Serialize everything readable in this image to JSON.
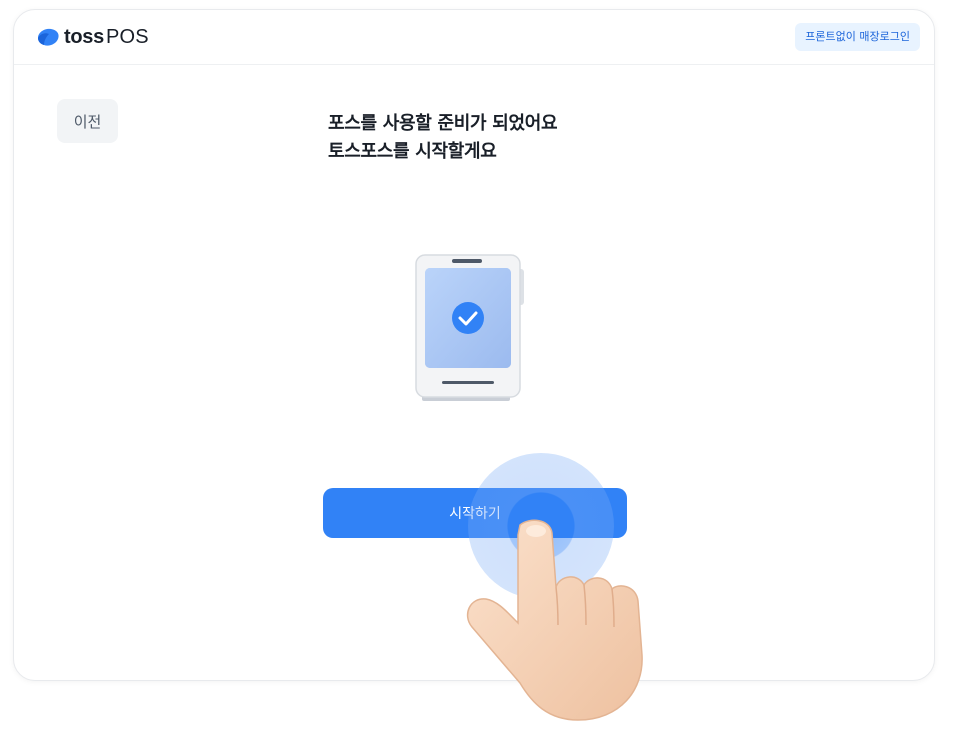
{
  "header": {
    "logo_toss": "toss",
    "logo_pos": "POS",
    "front_login_label": "프론트없이 매장로그인"
  },
  "nav": {
    "back_label": "이전"
  },
  "main": {
    "headline_line1": "포스를 사용할 준비가 되었어요",
    "headline_line2": "토스포스를 시작할게요",
    "device_icon": "pos-terminal-check-icon",
    "start_label": "시작하기"
  },
  "overlay": {
    "hand_icon": "pointing-hand-icon",
    "tap_icon": "tap-ripple"
  },
  "colors": {
    "accent": "#3182f6",
    "front_login_bg": "#e8f3ff",
    "front_login_text": "#1b64da",
    "back_bg": "#f2f4f6",
    "text_primary": "#191f28"
  }
}
